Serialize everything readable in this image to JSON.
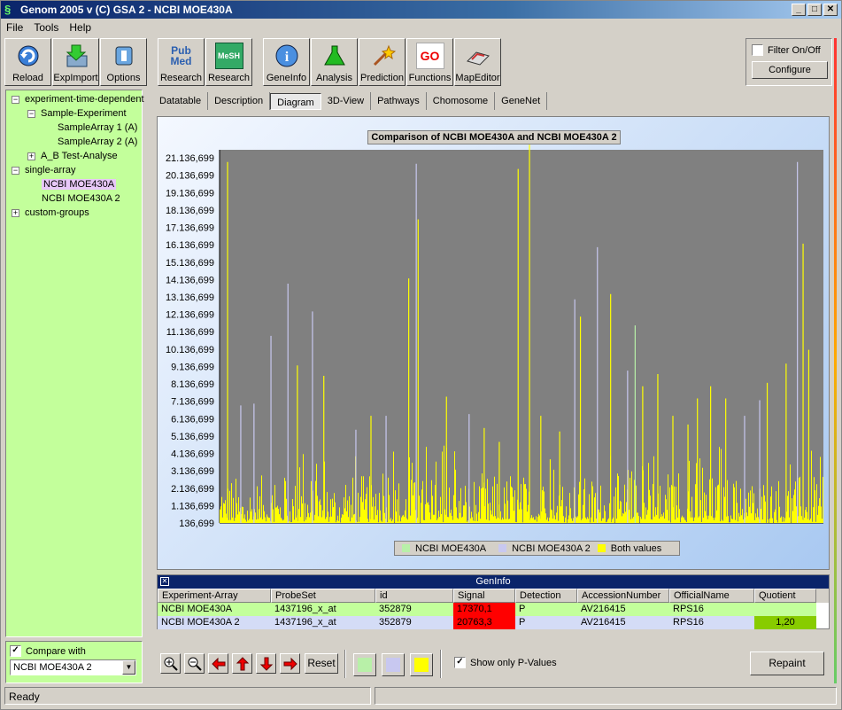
{
  "window": {
    "title": "Genom 2005 v       (C) GSA 2      - NCBI MOE430A",
    "controls": [
      "_",
      "□",
      "✕"
    ]
  },
  "menu": [
    "File",
    "Tools",
    "Help"
  ],
  "toolbar": {
    "group1": [
      {
        "label": "Reload",
        "icon": "reload-icon"
      },
      {
        "label": "ExpImport",
        "icon": "import-icon"
      },
      {
        "label": "Options",
        "icon": "options-icon"
      }
    ],
    "group2": [
      {
        "label": "Research",
        "icon": "pubmed-icon",
        "badge": "Pub Med"
      },
      {
        "label": "Research",
        "icon": "mesh-icon",
        "badge": "MeSH"
      }
    ],
    "group3": [
      {
        "label": "GeneInfo",
        "icon": "info-icon"
      },
      {
        "label": "Analysis",
        "icon": "flask-icon"
      },
      {
        "label": "Prediction",
        "icon": "wand-icon"
      },
      {
        "label": "Functions",
        "icon": "go-icon",
        "badge": "GO"
      },
      {
        "label": "MapEditor",
        "icon": "map-icon"
      }
    ]
  },
  "filter": {
    "checkbox_label": "Filter On/Off",
    "checked": false,
    "configure_label": "Configure"
  },
  "tree": {
    "items": [
      {
        "label": "experiment-time-dependent",
        "level": 0,
        "expander": "−"
      },
      {
        "label": "Sample-Experiment",
        "level": 1,
        "expander": "−"
      },
      {
        "label": "SampleArray 1 (A)",
        "level": 2
      },
      {
        "label": "SampleArray 2 (A)",
        "level": 2
      },
      {
        "label": "A_B Test-Analyse",
        "level": 1,
        "expander": "+"
      },
      {
        "label": "single-array",
        "level": 0,
        "expander": "−"
      },
      {
        "label": "NCBI MOE430A",
        "level": 1,
        "selected": true
      },
      {
        "label": "NCBI MOE430A 2",
        "level": 1
      },
      {
        "label": "custom-groups",
        "level": 0,
        "expander": "+"
      }
    ]
  },
  "compare": {
    "label": "Compare with",
    "checked": true,
    "selected": "NCBI MOE430A 2"
  },
  "tabs": [
    "Datatable",
    "Description",
    "Diagram",
    "3D-View",
    "Pathways",
    "Chomosome",
    "GeneNet"
  ],
  "active_tab": "Diagram",
  "chart_data": {
    "type": "bar",
    "title": "Comparison of NCBI MOE430A and NCBI MOE430A 2",
    "y_tick_labels": [
      "21.136,699",
      "20.136,699",
      "19.136,699",
      "18.136,699",
      "17.136,699",
      "16.136,699",
      "15.136,699",
      "14.136,699",
      "13.136,699",
      "12.136,699",
      "11.136,699",
      "10.136,699",
      "9.136,699",
      "8.136,699",
      "7.136,699",
      "6.136,699",
      "5.136,699",
      "4.136,699",
      "3.136,699",
      "2.136,699",
      "1.136,699",
      "136,699"
    ],
    "ylim": [
      136.699,
      21600
    ],
    "series": [
      {
        "name": "NCBI MOE430A",
        "color": "#b8f0a8"
      },
      {
        "name": "NCBI MOE430A 2",
        "color": "#c8c8f0"
      },
      {
        "name": "Both values",
        "color": "#ffff00"
      }
    ],
    "plot_background": "#808080",
    "peaks": [
      {
        "x": 0.02,
        "y": 20900,
        "s": "both"
      },
      {
        "x": 0.055,
        "y": 6900,
        "s": "a2"
      },
      {
        "x": 0.09,
        "y": 7000,
        "s": "a2"
      },
      {
        "x": 0.135,
        "y": 10900,
        "s": "a2"
      },
      {
        "x": 0.18,
        "y": 13900,
        "s": "a2"
      },
      {
        "x": 0.205,
        "y": 9200,
        "s": "both"
      },
      {
        "x": 0.245,
        "y": 12300,
        "s": "a2"
      },
      {
        "x": 0.275,
        "y": 8600,
        "s": "both"
      },
      {
        "x": 0.36,
        "y": 5500,
        "s": "a2"
      },
      {
        "x": 0.4,
        "y": 6300,
        "s": "both"
      },
      {
        "x": 0.44,
        "y": 6300,
        "s": "a2"
      },
      {
        "x": 0.5,
        "y": 14200,
        "s": "both"
      },
      {
        "x": 0.52,
        "y": 20800,
        "s": "a2"
      },
      {
        "x": 0.525,
        "y": 17600,
        "s": "both"
      },
      {
        "x": 0.6,
        "y": 7400,
        "s": "both"
      },
      {
        "x": 0.66,
        "y": 6400,
        "s": "a2"
      },
      {
        "x": 0.7,
        "y": 5600,
        "s": "both"
      },
      {
        "x": 0.74,
        "y": 4800,
        "s": "both"
      },
      {
        "x": 0.79,
        "y": 20500,
        "s": "both"
      },
      {
        "x": 0.82,
        "y": 21900,
        "s": "both"
      },
      {
        "x": 0.85,
        "y": 6300,
        "s": "both"
      },
      {
        "x": 0.875,
        "y": 3800,
        "s": "both"
      },
      {
        "x": 0.9,
        "y": 5400,
        "s": "both"
      },
      {
        "x": 0.94,
        "y": 13000,
        "s": "a2"
      },
      {
        "x": 0.955,
        "y": 12000,
        "s": "both"
      },
      {
        "x": 1.0,
        "y": 16000,
        "s": "a2"
      },
      {
        "x": 1.035,
        "y": 13300,
        "s": "both"
      },
      {
        "x": 1.08,
        "y": 8900,
        "s": "a2"
      },
      {
        "x": 1.1,
        "y": 11500,
        "s": "a1"
      },
      {
        "x": 1.12,
        "y": 8000,
        "s": "both"
      },
      {
        "x": 1.16,
        "y": 8700,
        "s": "both"
      },
      {
        "x": 1.2,
        "y": 6300,
        "s": "both"
      },
      {
        "x": 1.24,
        "y": 5800,
        "s": "both"
      },
      {
        "x": 1.265,
        "y": 7300,
        "s": "both"
      },
      {
        "x": 1.3,
        "y": 8000,
        "s": "both"
      },
      {
        "x": 1.34,
        "y": 7300,
        "s": "both"
      },
      {
        "x": 1.39,
        "y": 6300,
        "s": "a2"
      },
      {
        "x": 1.43,
        "y": 7200,
        "s": "a2"
      },
      {
        "x": 1.45,
        "y": 8200,
        "s": "both"
      },
      {
        "x": 1.5,
        "y": 9300,
        "s": "both"
      },
      {
        "x": 1.53,
        "y": 20900,
        "s": "a2"
      },
      {
        "x": 1.545,
        "y": 16200,
        "s": "both"
      },
      {
        "x": 1.56,
        "y": 10100,
        "s": "both"
      }
    ]
  },
  "geninfo": {
    "title": "GenInfo",
    "columns": [
      "Experiment-Array",
      "ProbeSet",
      "id",
      "Signal",
      "Detection",
      "AccessionNumber",
      "OfficialName",
      "Quotient"
    ],
    "rows": [
      {
        "cells": [
          "NCBI MOE430A",
          "1437196_x_at",
          "352879",
          "17370,1",
          "P",
          "AV216415",
          "RPS16",
          ""
        ],
        "bg": "#c3ff9b",
        "signal_bg": "#ff0000",
        "quot_bg": "#c3ff9b"
      },
      {
        "cells": [
          "NCBI MOE430A 2",
          "1437196_x_at",
          "352879",
          "20763,3",
          "P",
          "AV216415",
          "RPS16",
          "1,20"
        ],
        "bg": "#d4dcf6",
        "signal_bg": "#ff0000",
        "quot_bg": "#88cc00"
      }
    ]
  },
  "bottom": {
    "reset_label": "Reset",
    "show_p_label": "Show only P-Values",
    "show_p_checked": true,
    "repaint_label": "Repaint",
    "swatches": [
      "#b8f0a8",
      "#c8c8f0",
      "#ffff00"
    ]
  },
  "status": {
    "text": "Ready"
  }
}
